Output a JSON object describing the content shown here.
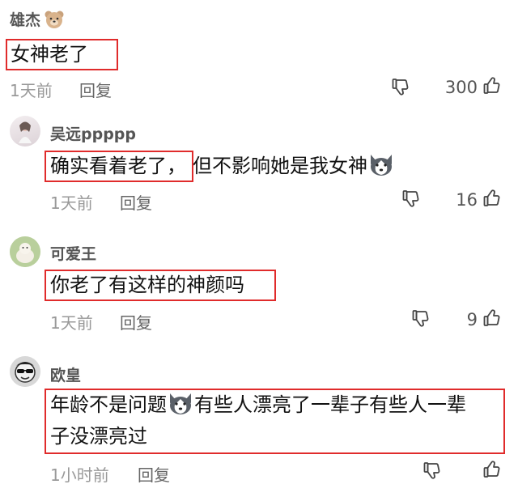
{
  "comments": [
    {
      "user": "雄杰",
      "text": "女神老了",
      "time": "1天前",
      "reply": "回复",
      "likes": "300"
    },
    {
      "user": "吴远ppppp",
      "text_highlight": "确实看着老了，",
      "text_rest": "但不影响她是我女神",
      "time": "1天前",
      "reply": "回复",
      "likes": "16"
    },
    {
      "user": "可爱王",
      "text": "你老了有这样的神颜吗",
      "time": "1天前",
      "reply": "回复",
      "likes": "9"
    },
    {
      "user": "欧皇",
      "line1_before": "年龄不是问题",
      "line1_after": "有些人漂亮了一辈子有些人一辈",
      "line2": "子没漂亮过",
      "time": "1小时前",
      "reply": "回复",
      "likes": ""
    }
  ],
  "colors": {
    "highlight_border": "#e02b2b",
    "meta_text": "#999999",
    "username_text": "#555555"
  },
  "icons": {
    "like": "thumbs-up-outline-icon",
    "dislike": "thumbs-down-outline-icon",
    "user_badge": "bear-face-icon",
    "inline_emoji": "husky-dog-emoji"
  }
}
